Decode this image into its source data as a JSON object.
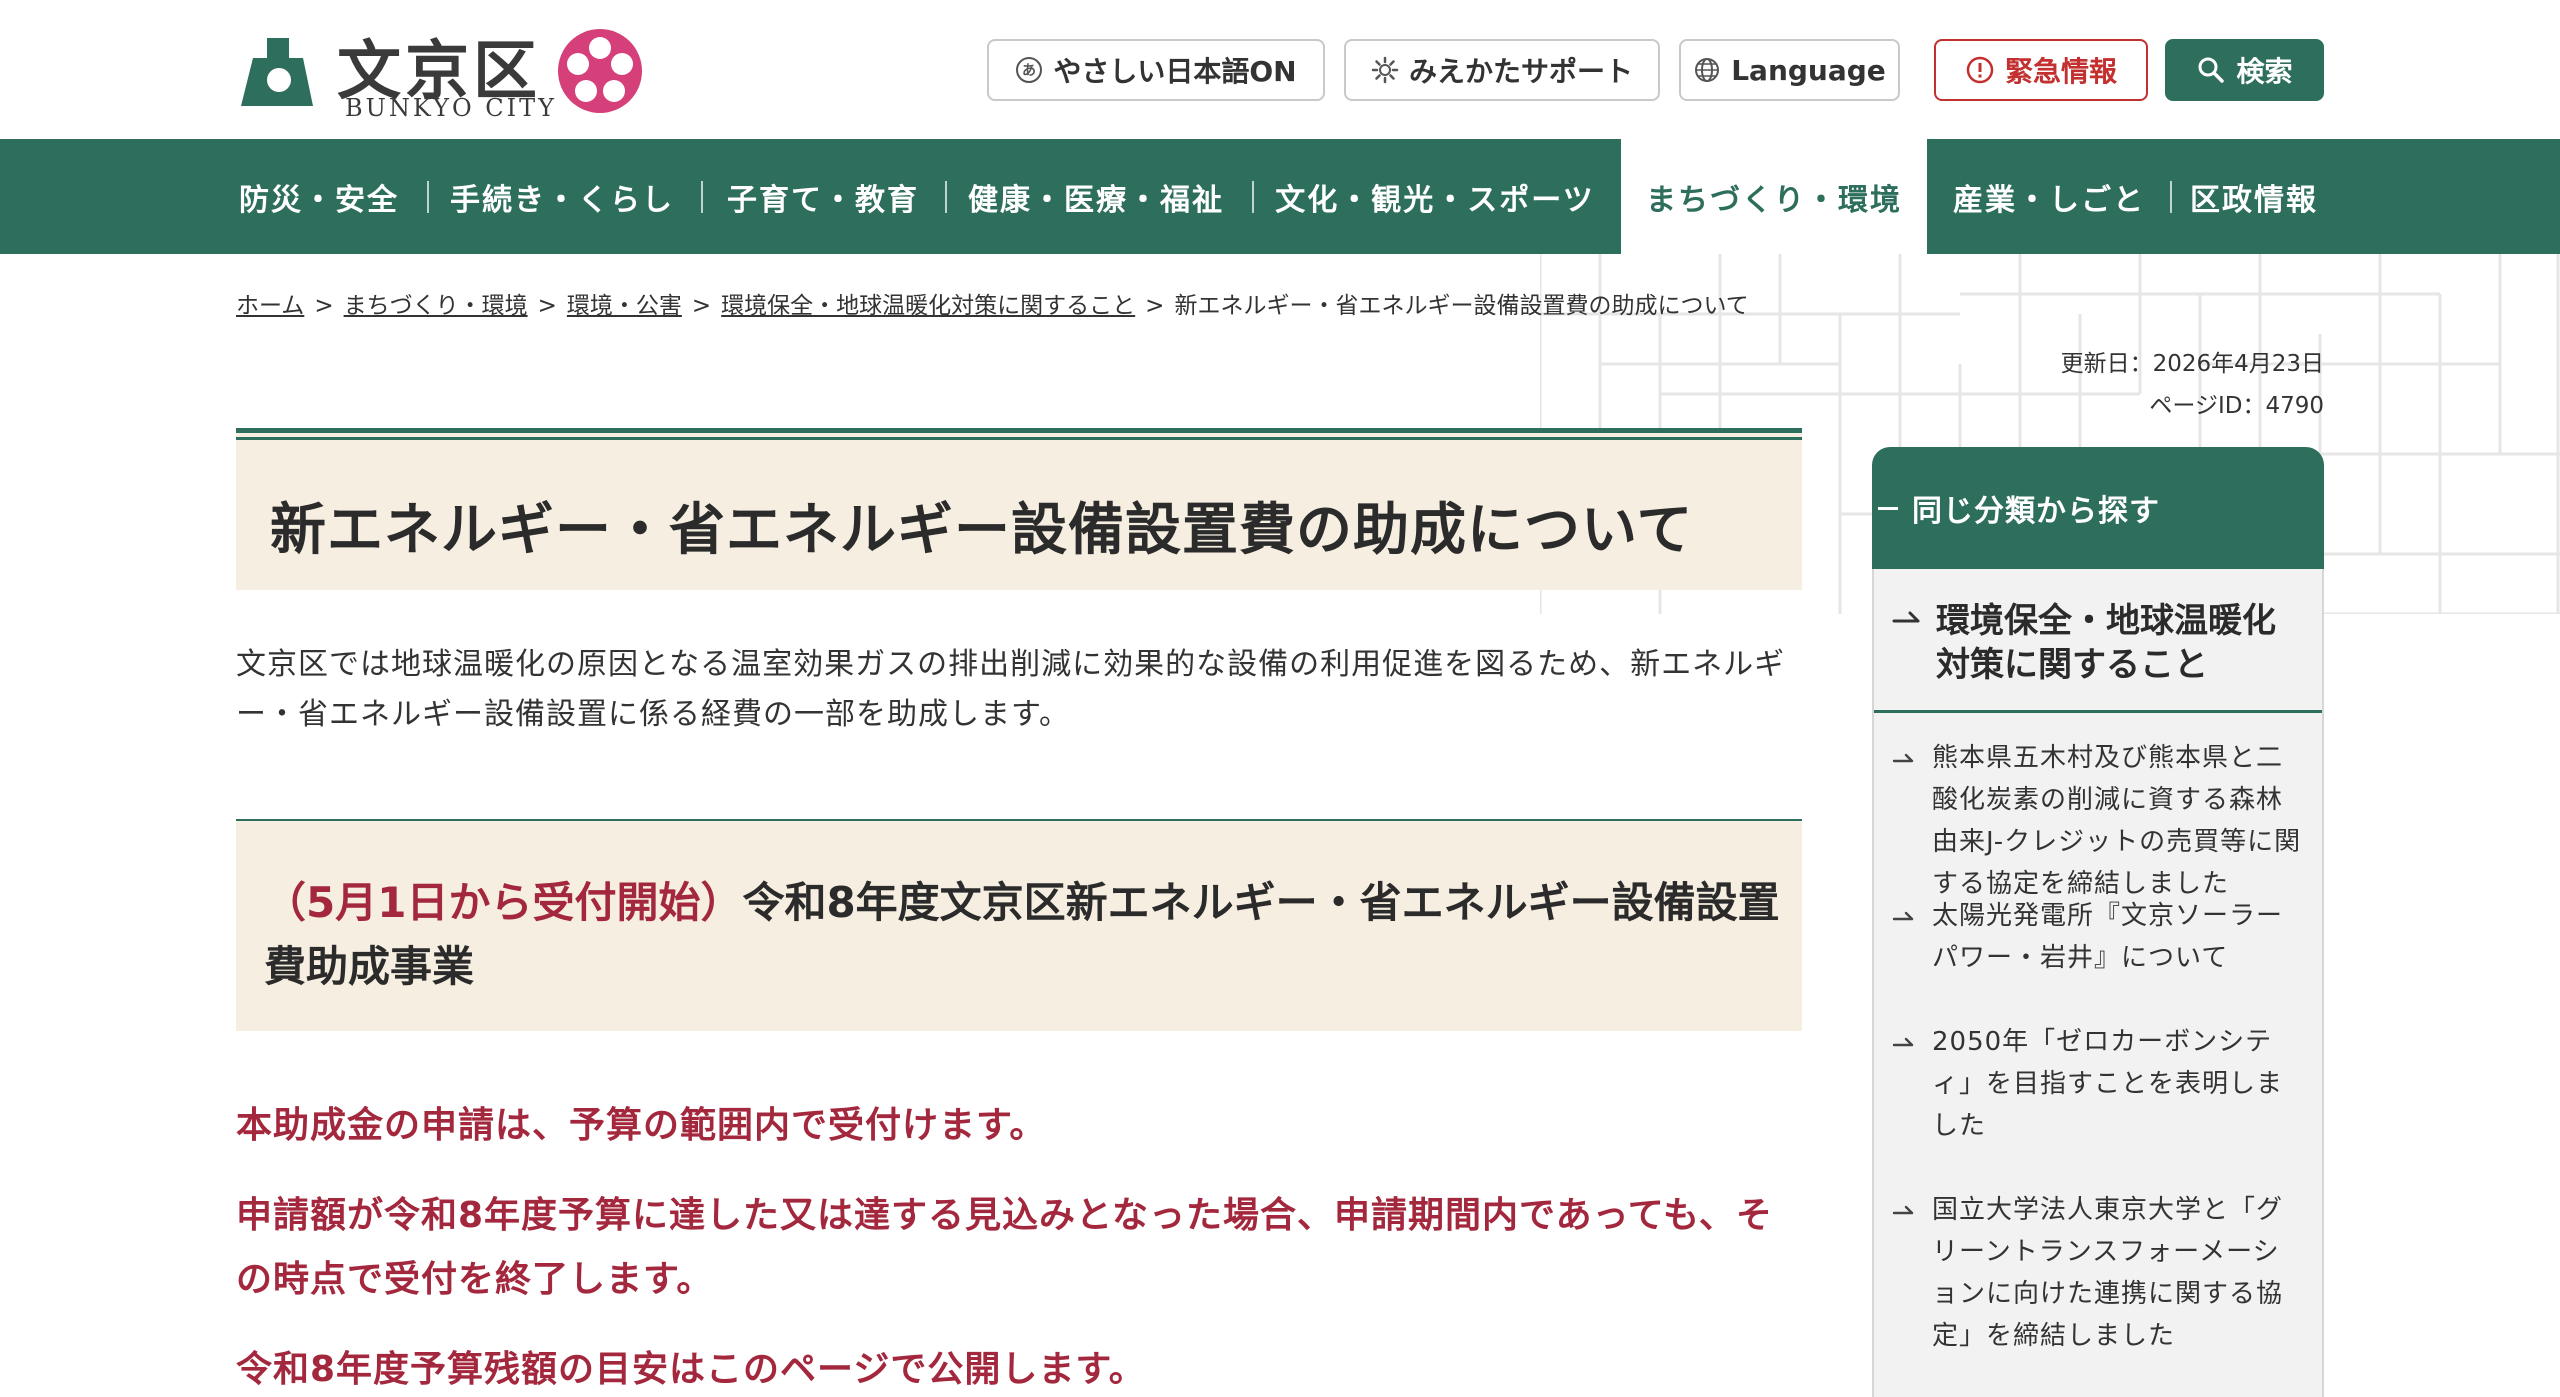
{
  "header": {
    "logo_title": "文京区",
    "logo_sub": "BUNKYO CITY",
    "buttons": {
      "yasashii": "やさしい日本語ON",
      "yasashii_icon_char": "あ",
      "miekata": "みえかたサポート",
      "language": "Language",
      "kinkyu": "緊急情報",
      "search": "検索"
    },
    "colors": {
      "brand": "#2e6e5c",
      "alert": "#c2302f",
      "emblem": "#d6407a"
    }
  },
  "nav": {
    "items": [
      {
        "label": "防災・安全"
      },
      {
        "label": "手続き・くらし"
      },
      {
        "label": "子育て・教育"
      },
      {
        "label": "健康・医療・福祉"
      },
      {
        "label": "文化・観光・スポーツ"
      },
      {
        "label": "まちづくり・環境",
        "active": true
      },
      {
        "label": "産業・しごと"
      },
      {
        "label": "区政情報"
      }
    ]
  },
  "breadcrumb": {
    "items": [
      {
        "label": "ホーム"
      },
      {
        "label": "まちづくり・環境"
      },
      {
        "label": "環境・公害"
      },
      {
        "label": "環境保全・地球温暖化対策に関すること"
      }
    ],
    "current": "新エネルギー・省エネルギー設備設置費の助成について",
    "separator": ">"
  },
  "meta": {
    "updated": "更新日：2026年4月23日",
    "page_id": "ページID：4790"
  },
  "main": {
    "title": "新エネルギー・省エネルギー設備設置費の助成について",
    "lead": "文京区では地球温暖化の原因となる温室効果ガスの排出削減に効果的な設備の利用促進を図るため、新エネルギー・省エネルギー設備設置に係る経費の一部を助成します。",
    "h2_highlight": "（5月1日から受付開始）",
    "h2_rest": "令和8年度文京区新エネルギー・省エネルギー設備設置費助成事業",
    "notices": [
      "本助成金の申請は、予算の範囲内で受付けます。",
      "申請額が令和8年度予算に達した又は達する見込みとなった場合、申請期間内であっても、その時点で受付を終了します。",
      "令和8年度予算残額の目安はこのページで公開します。"
    ]
  },
  "sidebar": {
    "heading": "同じ分類から探す",
    "parent": "環境保全・地球温暖化対策に関すること",
    "items": [
      {
        "label": "熊本県五木村及び熊本県と二酸化炭素の削減に資する森林由来J-クレジットの売買等に関する協定を締結しました"
      },
      {
        "label": "太陽光発電所『文京ソーラーパワー・岩井』について"
      },
      {
        "label": "2050年「ゼロカーボンシティ」を目指すことを表明しました"
      },
      {
        "label": "国立大学法人東京大学と「グリーントランスフォーメーションに向けた連携に関する協定」を締結しました"
      }
    ]
  }
}
